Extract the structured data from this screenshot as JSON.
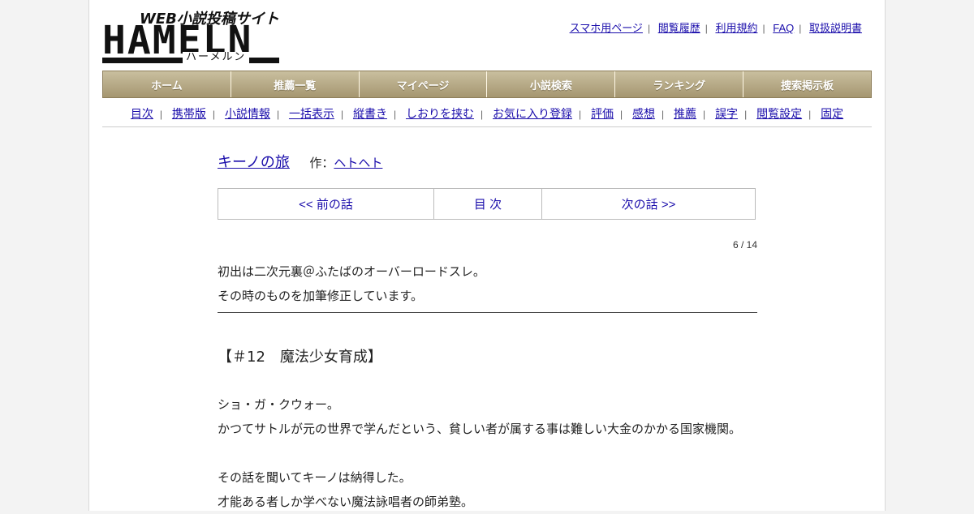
{
  "logo": {
    "tagline": "WEB小説投稿サイト",
    "wordmark": "HAMELN",
    "kana": "ハーメルン"
  },
  "top_links": [
    "スマホ用ページ",
    "閲覧履歴",
    "利用規約",
    "FAQ",
    "取扱説明書"
  ],
  "main_nav": [
    "ホーム",
    "推薦一覧",
    "マイページ",
    "小説検索",
    "ランキング",
    "捜索掲示板"
  ],
  "sub_nav": [
    "目次",
    "携帯版",
    "小説情報",
    "一括表示",
    "縦書き",
    "しおりを挟む",
    "お気に入り登録",
    "評価",
    "感想",
    "推薦",
    "誤字",
    "閲覧設定",
    "固定"
  ],
  "novel": {
    "title": "キーノの旅",
    "author_prefix": "作：",
    "author": "ヘトヘト"
  },
  "pager": {
    "prev": "<< 前の話",
    "toc": "目 次",
    "next": "次の話 >>"
  },
  "page_number": "6 / 14",
  "preface": [
    "初出は二次元裏＠ふたばのオーバーロードスレ。",
    "その時のものを加筆修正しています。"
  ],
  "chapter_title": "【＃12　魔法少女育成】",
  "body": [
    "ショ・ガ・クウォー。",
    "かつてサトルが元の世界で学んだという、貧しい者が属する事は難しい大金のかかる国家機関。",
    "",
    "その話を聞いてキーノは納得した。",
    "才能ある者しか学べない魔法詠唱者の師弟塾。"
  ]
}
